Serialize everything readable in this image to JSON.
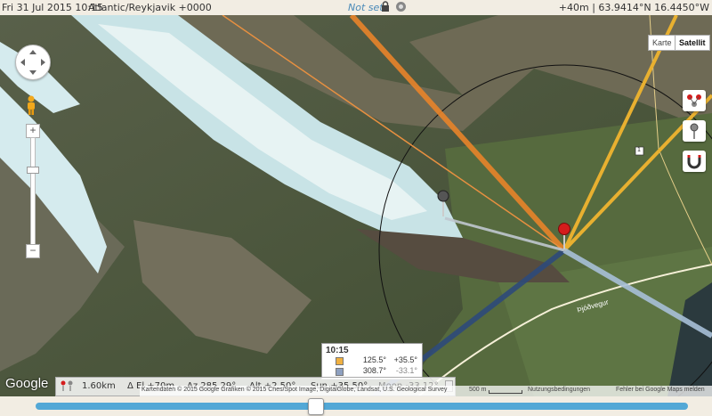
{
  "topbar": {
    "date": "Fri 31 Jul 2015 10:15",
    "timezone": "Atlantic/Reykjavik +0000",
    "not_set": "Not set",
    "coords": "+40m | 63.9414°N 16.4450°W"
  },
  "map_type": {
    "map": "Karte",
    "satellite": "Satellit"
  },
  "zoom": {
    "in": "+",
    "out": "−"
  },
  "info_box": {
    "time": "10:15",
    "rows": [
      {
        "azimuth": "125.5°",
        "altitude": "+35.5°",
        "color": "#f0b040"
      },
      {
        "azimuth": "308.7°",
        "altitude": "-33.1°",
        "color": "#8ea0c0"
      }
    ]
  },
  "status": {
    "distance": "1.60km",
    "elevation": "Δ El  +70m",
    "azimuth": "Az 285.29°",
    "altitude": "Alt  +2.50°",
    "sun": "Sun +35.50°",
    "moon": "Moon -33.12°"
  },
  "map_labels": {
    "road_name": "Þjóðvegur",
    "road_number": "1"
  },
  "footer": {
    "google": "Google",
    "copyright": "Kartendaten © 2015 Google Grafiken © 2015 Cnes/Spot Image, DigitalGlobe, Landsat, U.S. Geological Survey",
    "scale": "500 m",
    "terms": "Nutzungsbedingungen",
    "report": "Fehler bei Google Maps melden"
  },
  "time_slider": {
    "position": 0.43
  },
  "colors": {
    "sun_line": "#e8842a",
    "sunset_line": "#e8b030",
    "moon_line": "#2e4a7a",
    "sightline": "#a8c0d8",
    "slider": "#53a8d6"
  },
  "icons": [
    "lock-icon",
    "toggle-icon",
    "pan-control-icon",
    "pegman-icon",
    "markers-icon",
    "pin-icon",
    "magnet-icon",
    "distance-icon"
  ]
}
